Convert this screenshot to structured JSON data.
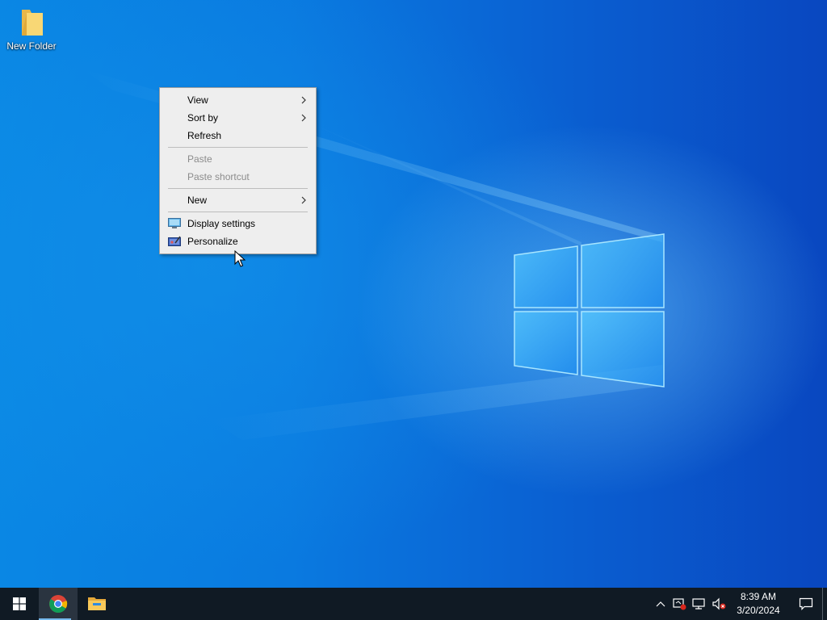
{
  "desktop": {
    "icons": [
      {
        "label": "New Folder",
        "icon": "folder-icon"
      }
    ]
  },
  "context_menu": {
    "items": [
      {
        "label": "View",
        "submenu": true,
        "enabled": true
      },
      {
        "label": "Sort by",
        "submenu": true,
        "enabled": true
      },
      {
        "label": "Refresh",
        "submenu": false,
        "enabled": true
      },
      {
        "label": "Paste",
        "submenu": false,
        "enabled": false
      },
      {
        "label": "Paste shortcut",
        "submenu": false,
        "enabled": false
      },
      {
        "label": "New",
        "submenu": true,
        "enabled": true
      },
      {
        "label": "Display settings",
        "submenu": false,
        "enabled": true,
        "icon": "display-icon"
      },
      {
        "label": "Personalize",
        "submenu": false,
        "enabled": true,
        "icon": "personalize-icon"
      }
    ]
  },
  "taskbar": {
    "start_icon": "windows-logo-icon",
    "pinned": [
      {
        "icon": "chrome-icon",
        "active": true
      },
      {
        "icon": "file-explorer-icon",
        "active": false
      }
    ],
    "tray": {
      "icons": [
        "chevron-up-icon",
        "security-icon",
        "network-icon",
        "volume-muted-icon"
      ],
      "time": "8:39 AM",
      "date": "3/20/2024",
      "notification_icon": "action-center-icon"
    }
  },
  "colors": {
    "taskbar": "#101a24",
    "menu_bg": "#eeeeee",
    "accent": "#76b9ed"
  }
}
